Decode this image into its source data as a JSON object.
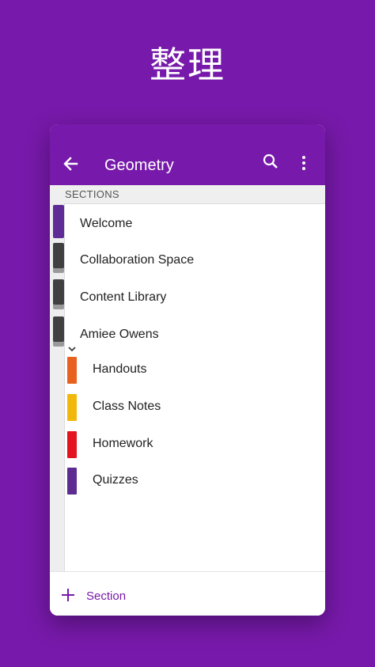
{
  "promo": {
    "headline": "整理"
  },
  "appbar": {
    "title": "Geometry"
  },
  "sections_header": "SECTIONS",
  "sections": [
    {
      "label": "Welcome"
    },
    {
      "label": "Collaboration Space"
    },
    {
      "label": "Content Library"
    }
  ],
  "group": {
    "label": "Amiee Owens",
    "sections": [
      {
        "label": "Handouts",
        "color": "#e8611f"
      },
      {
        "label": "Class Notes",
        "color": "#f2b70b"
      },
      {
        "label": "Homework",
        "color": "#e3131f"
      },
      {
        "label": "Quizzes",
        "color": "#5c2c91"
      }
    ]
  },
  "footer": {
    "add_label": "Section"
  },
  "colors": {
    "brand": "#7719aa"
  },
  "icons": [
    "back-arrow-icon",
    "search-icon",
    "more-vert-icon",
    "chevron-down-icon",
    "plus-icon"
  ]
}
